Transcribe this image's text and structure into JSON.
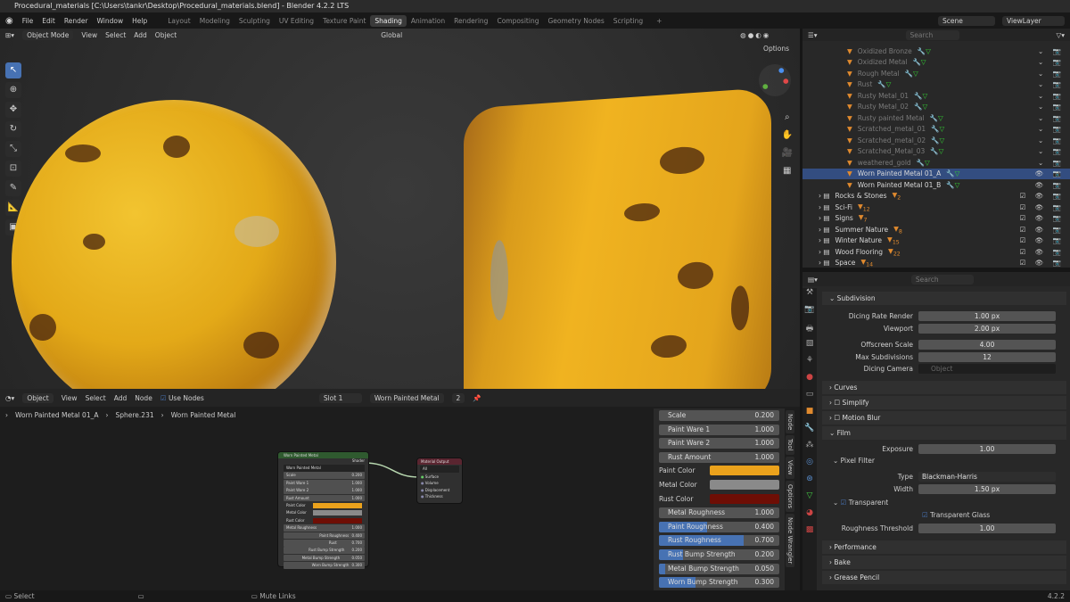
{
  "window_title": "Procedural_materials [C:\\Users\\tankr\\Desktop\\Procedural_materials.blend] - Blender 4.2.2 LTS",
  "menu": [
    "File",
    "Edit",
    "Render",
    "Window",
    "Help"
  ],
  "workspaces": [
    "Layout",
    "Modeling",
    "Sculpting",
    "UV Editing",
    "Texture Paint",
    "Shading",
    "Animation",
    "Rendering",
    "Compositing",
    "Geometry Nodes",
    "Scripting"
  ],
  "active_workspace": "Shading",
  "scene": "Scene",
  "view_layer": "ViewLayer",
  "viewport": {
    "mode": "Object Mode",
    "menus": [
      "View",
      "Select",
      "Add",
      "Object"
    ],
    "orientation": "Global",
    "options": "Options"
  },
  "outliner": {
    "search_placeholder": "Search",
    "materials": [
      "Oxidized Bronze",
      "Oxidized Metal",
      "Rough Metal",
      "Rust",
      "Rusty Metal_01",
      "Rusty Metal_02",
      "Rusty painted Metal",
      "Scratched_metal_01",
      "Scratched_metal_02",
      "Scratched_Metal_03",
      "weathered_gold",
      "Worn Painted Metal 01_A",
      "Worn Painted Metal 01_B"
    ],
    "selected": "Worn Painted Metal 01_A",
    "collections": [
      {
        "name": "Rocks & Stones",
        "count": "2"
      },
      {
        "name": "Sci-Fi",
        "count": "12"
      },
      {
        "name": "Signs",
        "count": "7"
      },
      {
        "name": "Summer Nature",
        "count": "8"
      },
      {
        "name": "Winter Nature",
        "count": "15"
      },
      {
        "name": "Wood Flooring",
        "count": "22"
      },
      {
        "name": "Space",
        "count": "14"
      }
    ]
  },
  "properties": {
    "search_placeholder": "Search",
    "subdivision": "Subdivision",
    "dicing_render_label": "Dicing Rate Render",
    "dicing_render": "1.00 px",
    "viewport_label": "Viewport",
    "viewport": "2.00 px",
    "offscreen_label": "Offscreen Scale",
    "offscreen": "4.00",
    "maxsub_label": "Max Subdivisions",
    "maxsub": "12",
    "camera_label": "Dicing Camera",
    "camera_placeholder": "Object",
    "curves": "Curves",
    "simplify": "Simplify",
    "motion_blur": "Motion Blur",
    "film": "Film",
    "exposure_label": "Exposure",
    "exposure": "1.00",
    "pixel_filter": "Pixel Filter",
    "type_label": "Type",
    "type": "Blackman-Harris",
    "width_label": "Width",
    "width": "1.50 px",
    "transparent": "Transparent",
    "transparent_glass": "Transparent Glass",
    "rough_label": "Roughness Threshold",
    "rough": "1.00",
    "performance": "Performance",
    "bake": "Bake",
    "grease_pencil": "Grease Pencil"
  },
  "node_editor": {
    "type": "Object",
    "menus": [
      "View",
      "Select",
      "Add",
      "Node"
    ],
    "use_nodes": "Use Nodes",
    "slot": "Slot 1",
    "material": "Worn Painted Metal",
    "users": "2",
    "breadcrumb": [
      "Worn Painted Metal 01_A",
      "Sphere.231",
      "Worn Painted Metal"
    ],
    "group_node": {
      "title": "Worn Painted Metal",
      "output": "Shader",
      "datablock": "Worn Painted Metal"
    },
    "output_node": {
      "title": "Material Output",
      "target": "All",
      "inputs": [
        "Surface",
        "Volume",
        "Displacement",
        "Thickness"
      ]
    },
    "fields": [
      {
        "label": "Scale",
        "value": "0.200",
        "fill": 0
      },
      {
        "label": "Paint Ware 1",
        "value": "1.000",
        "fill": 0
      },
      {
        "label": "Paint Ware 2",
        "value": "1.000",
        "fill": 0
      },
      {
        "label": "Rust Amount",
        "value": "1.000",
        "fill": 0
      }
    ],
    "colors": [
      {
        "label": "Paint Color",
        "hex": "#eba21c"
      },
      {
        "label": "Metal Color",
        "hex": "#8a8a8a"
      },
      {
        "label": "Rust Color",
        "hex": "#6e0e05"
      }
    ],
    "fields2": [
      {
        "label": "Metal Roughness",
        "value": "1.000",
        "fill": 0
      },
      {
        "label": "Paint Roughness",
        "value": "0.400",
        "fill": 0.4
      },
      {
        "label": "Rust Roughness",
        "value": "0.700",
        "fill": 0.7
      },
      {
        "label": "Rust Bump Strength",
        "value": "0.200",
        "fill": 0.2
      },
      {
        "label": "Metal Bump Strength",
        "value": "0.050",
        "fill": 0.05
      },
      {
        "label": "Worn Bump Strength",
        "value": "0.300",
        "fill": 0.3
      }
    ],
    "tabs": [
      "Node",
      "Tool",
      "View",
      "Options",
      "Node Wrangler"
    ]
  },
  "status": {
    "select": "Select",
    "mute": "Mute Links",
    "version": "4.2.2"
  }
}
